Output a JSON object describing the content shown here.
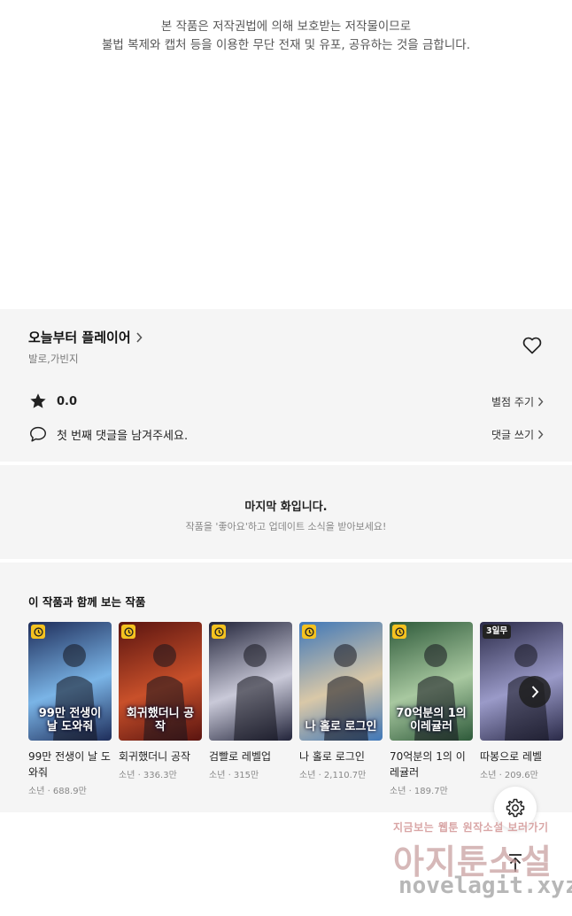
{
  "notice": {
    "line1": "본 작품은 저작권법에 의해 보호받는 저작물이므로",
    "line2": "불법 복제와 캡처 등을 이용한 무단 전재 및 유포, 공유하는 것을 금합니다."
  },
  "series": {
    "title": "오늘부터 플레이어",
    "authors": "발로,가빈지"
  },
  "rating": {
    "value": "0.0",
    "action": "별점 주기"
  },
  "comment": {
    "prompt": "첫 번째 댓글을 남겨주세요.",
    "action": "댓글 쓰기"
  },
  "last_episode": {
    "title": "마지막 화입니다.",
    "subtitle": "작품을 '좋아요'하고 업데이트 소식을 받아보세요!"
  },
  "recommend": {
    "title": "이 작품과 함께 보는 작품",
    "items": [
      {
        "title": "99만 전생이 날 도와줘",
        "meta": "소년 · 688.9만",
        "badge": "clock",
        "cover_text": "99만 전생이 날 도와줘",
        "colors": [
          "#1e2d5a",
          "#7ab4e6"
        ]
      },
      {
        "title": "회귀했더니 공작",
        "meta": "소년 · 336.3만",
        "badge": "clock",
        "cover_text": "회귀했더니 공작",
        "colors": [
          "#5a1410",
          "#c8502a"
        ]
      },
      {
        "title": "검빨로 레벨업",
        "meta": "소년 · 315만",
        "badge": "clock",
        "cover_text": "",
        "colors": [
          "#22243a",
          "#c9c9d8"
        ]
      },
      {
        "title": "나 홀로 로그인",
        "meta": "소년 · 2,110.7만",
        "badge": "clock",
        "cover_text": "나 홀로 로그인",
        "colors": [
          "#3f77b8",
          "#d9c8a8"
        ]
      },
      {
        "title": "70억분의 1의 이레귤러",
        "meta": "소년 · 189.7만",
        "badge": "clock",
        "cover_text": "70억분의 1의 이레귤러",
        "colors": [
          "#2e5a3a",
          "#a8c8a0"
        ]
      },
      {
        "title": "따봉으로 레벨",
        "meta": "소년 · 209.6만",
        "badge": "3일무",
        "cover_text": "",
        "colors": [
          "#2a2a48",
          "#9a9ac8"
        ]
      }
    ]
  },
  "watermark": {
    "line1": "지금보는 웹툰 원작소설 보러가기",
    "line2": "아지툰소설",
    "line3": "novelagit.xyz"
  },
  "colors": {
    "panel_bg": "#f5f5f5",
    "badge_yellow": "#f4c21f",
    "text_dark": "#222222",
    "text_muted": "#888888"
  }
}
